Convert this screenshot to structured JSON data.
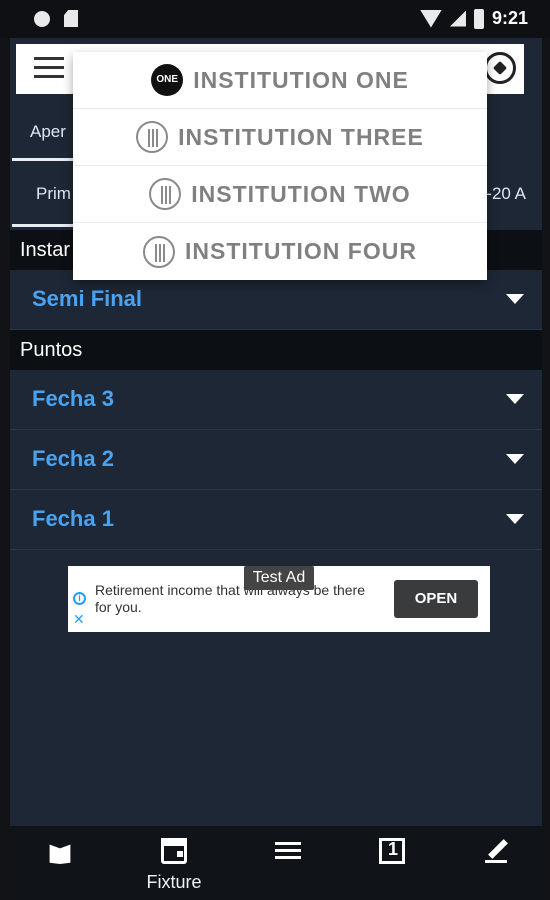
{
  "status_bar": {
    "time": "9:21"
  },
  "tabs": {
    "top_tab_label": "Aper",
    "second_left_label": "Prim",
    "second_right_label": "-20 A"
  },
  "sections": {
    "instancias_header": "Instar",
    "semi_final_label": "Semi Final",
    "puntos_header": "Puntos",
    "fecha_rows": [
      "Fecha 3",
      "Fecha 2",
      "Fecha 1"
    ]
  },
  "dropdown": {
    "items": [
      {
        "label": "INSTITUTION ONE",
        "icon_text": "ONE"
      },
      {
        "label": "INSTITUTION THREE"
      },
      {
        "label": "INSTITUTION TWO"
      },
      {
        "label": "INSTITUTION FOUR"
      }
    ]
  },
  "ad": {
    "text": "Retirement income that will always be there for you.",
    "button_label": "OPEN",
    "test_tag": "Test Ad",
    "info_glyph": "i",
    "close_glyph": "✕"
  },
  "bottom_nav": {
    "items": [
      {
        "label": ""
      },
      {
        "label": "Fixture"
      },
      {
        "label": ""
      },
      {
        "label": ""
      },
      {
        "label": ""
      }
    ]
  }
}
